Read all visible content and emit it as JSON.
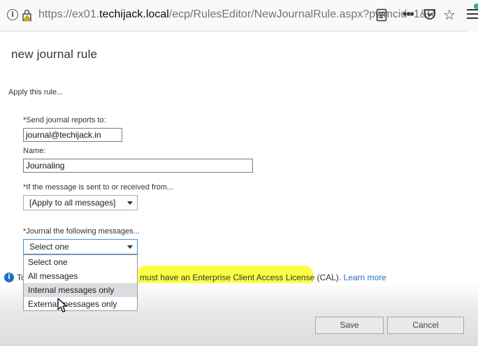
{
  "browser": {
    "url_prefix": "https://ex01.",
    "url_host": "techijack.local",
    "url_rest": "/ecp/RulesEditor/NewJournalRule.aspx?pwmcid=1&R",
    "menu_dots": "•••"
  },
  "page": {
    "title": "new journal rule",
    "apply_label": "Apply this rule..."
  },
  "form": {
    "send_reports_label": "*Send journal reports to:",
    "send_reports_value": "journal@techijack.in",
    "name_label": "Name:",
    "name_value": "Journaling",
    "sent_received_label": "*If the message is sent to or received from...",
    "sent_received_value": "[Apply to all messages]",
    "journal_messages_label": "*Journal the following messages...",
    "journal_messages_value": "Select one",
    "journal_options": [
      "Select one",
      "All messages",
      "Internal messages only",
      "External messages only"
    ],
    "hovered_option_index": 2
  },
  "info": {
    "prefix": "To",
    "text": "must have an Enterprise Client Access License (CAL). ",
    "link": "Learn more"
  },
  "buttons": {
    "save": "Save",
    "cancel": "Cancel"
  },
  "colors": {
    "highlight": "#fbff2f",
    "link": "#2a6ebb",
    "info_icon": "#1e6fc4"
  }
}
